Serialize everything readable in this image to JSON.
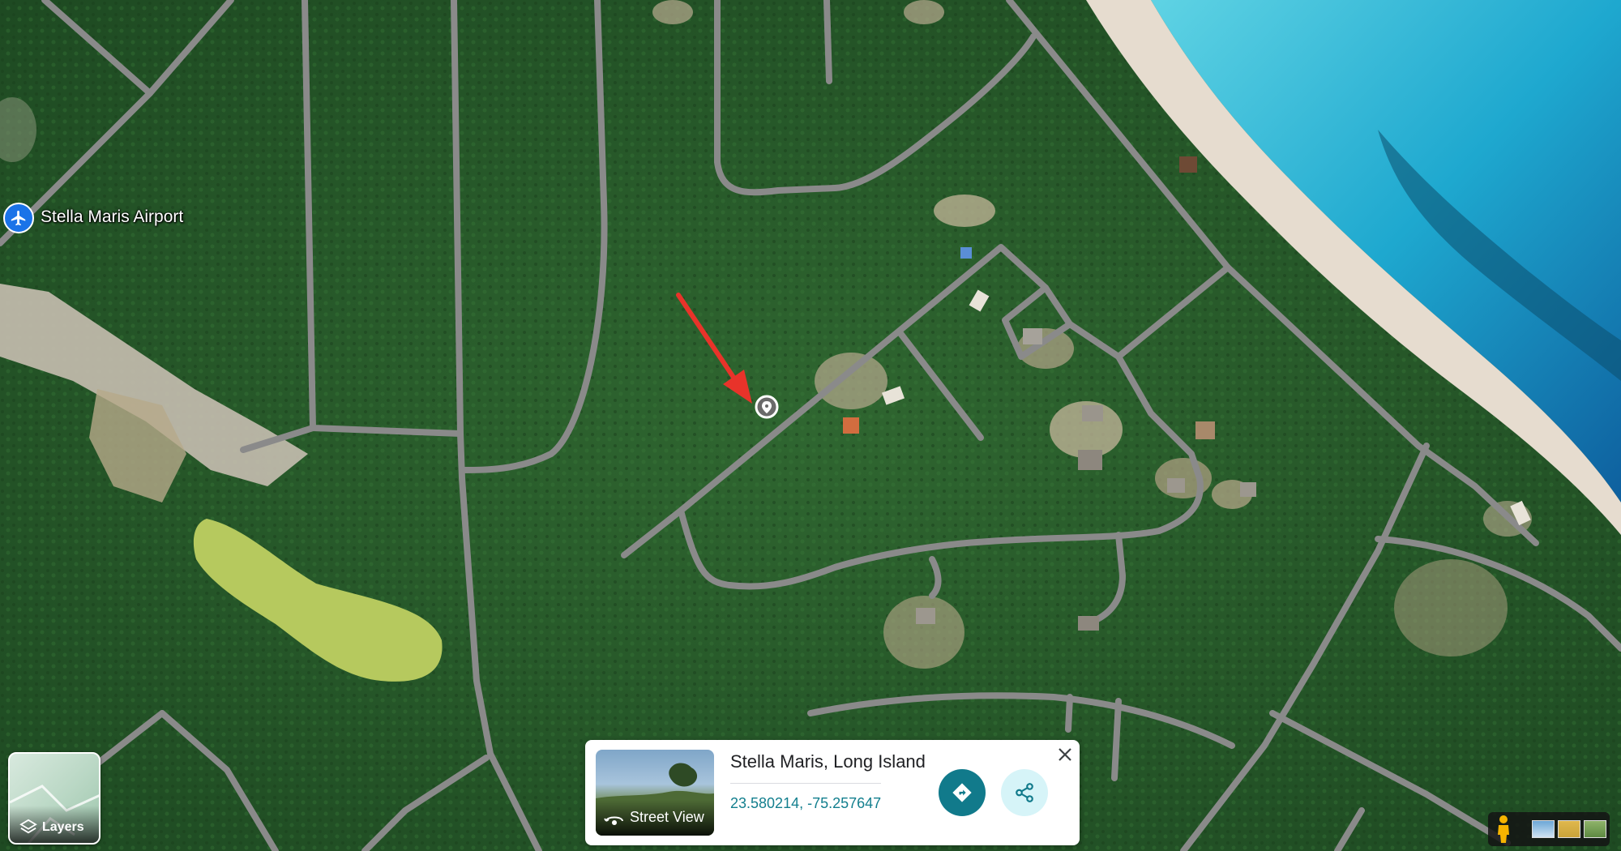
{
  "map": {
    "place_label": "Stella Maris Airport",
    "place_icon": "airplane-icon",
    "pin_icon": "location-pin-icon",
    "annotation": "red-arrow"
  },
  "layers": {
    "label": "Layers",
    "icon": "layers-icon"
  },
  "place_card": {
    "title": "Stella Maris, Long Island",
    "coordinates": "23.580214, -75.257647",
    "street_view_label": "Street View",
    "directions_icon": "directions-icon",
    "share_icon": "share-icon",
    "close_icon": "close-icon"
  },
  "bottom_controls": {
    "pegman_icon": "pegman-icon",
    "tiles": [
      "map-tile",
      "terrain-tile",
      "satellite-tile"
    ]
  },
  "colors": {
    "vegetation": "#2a5a2c",
    "road": "#8a8a8a",
    "ocean": "#2ab8d8",
    "beach": "#e6dccf",
    "accent": "#117a8b",
    "annotation_arrow": "#e8332a"
  }
}
